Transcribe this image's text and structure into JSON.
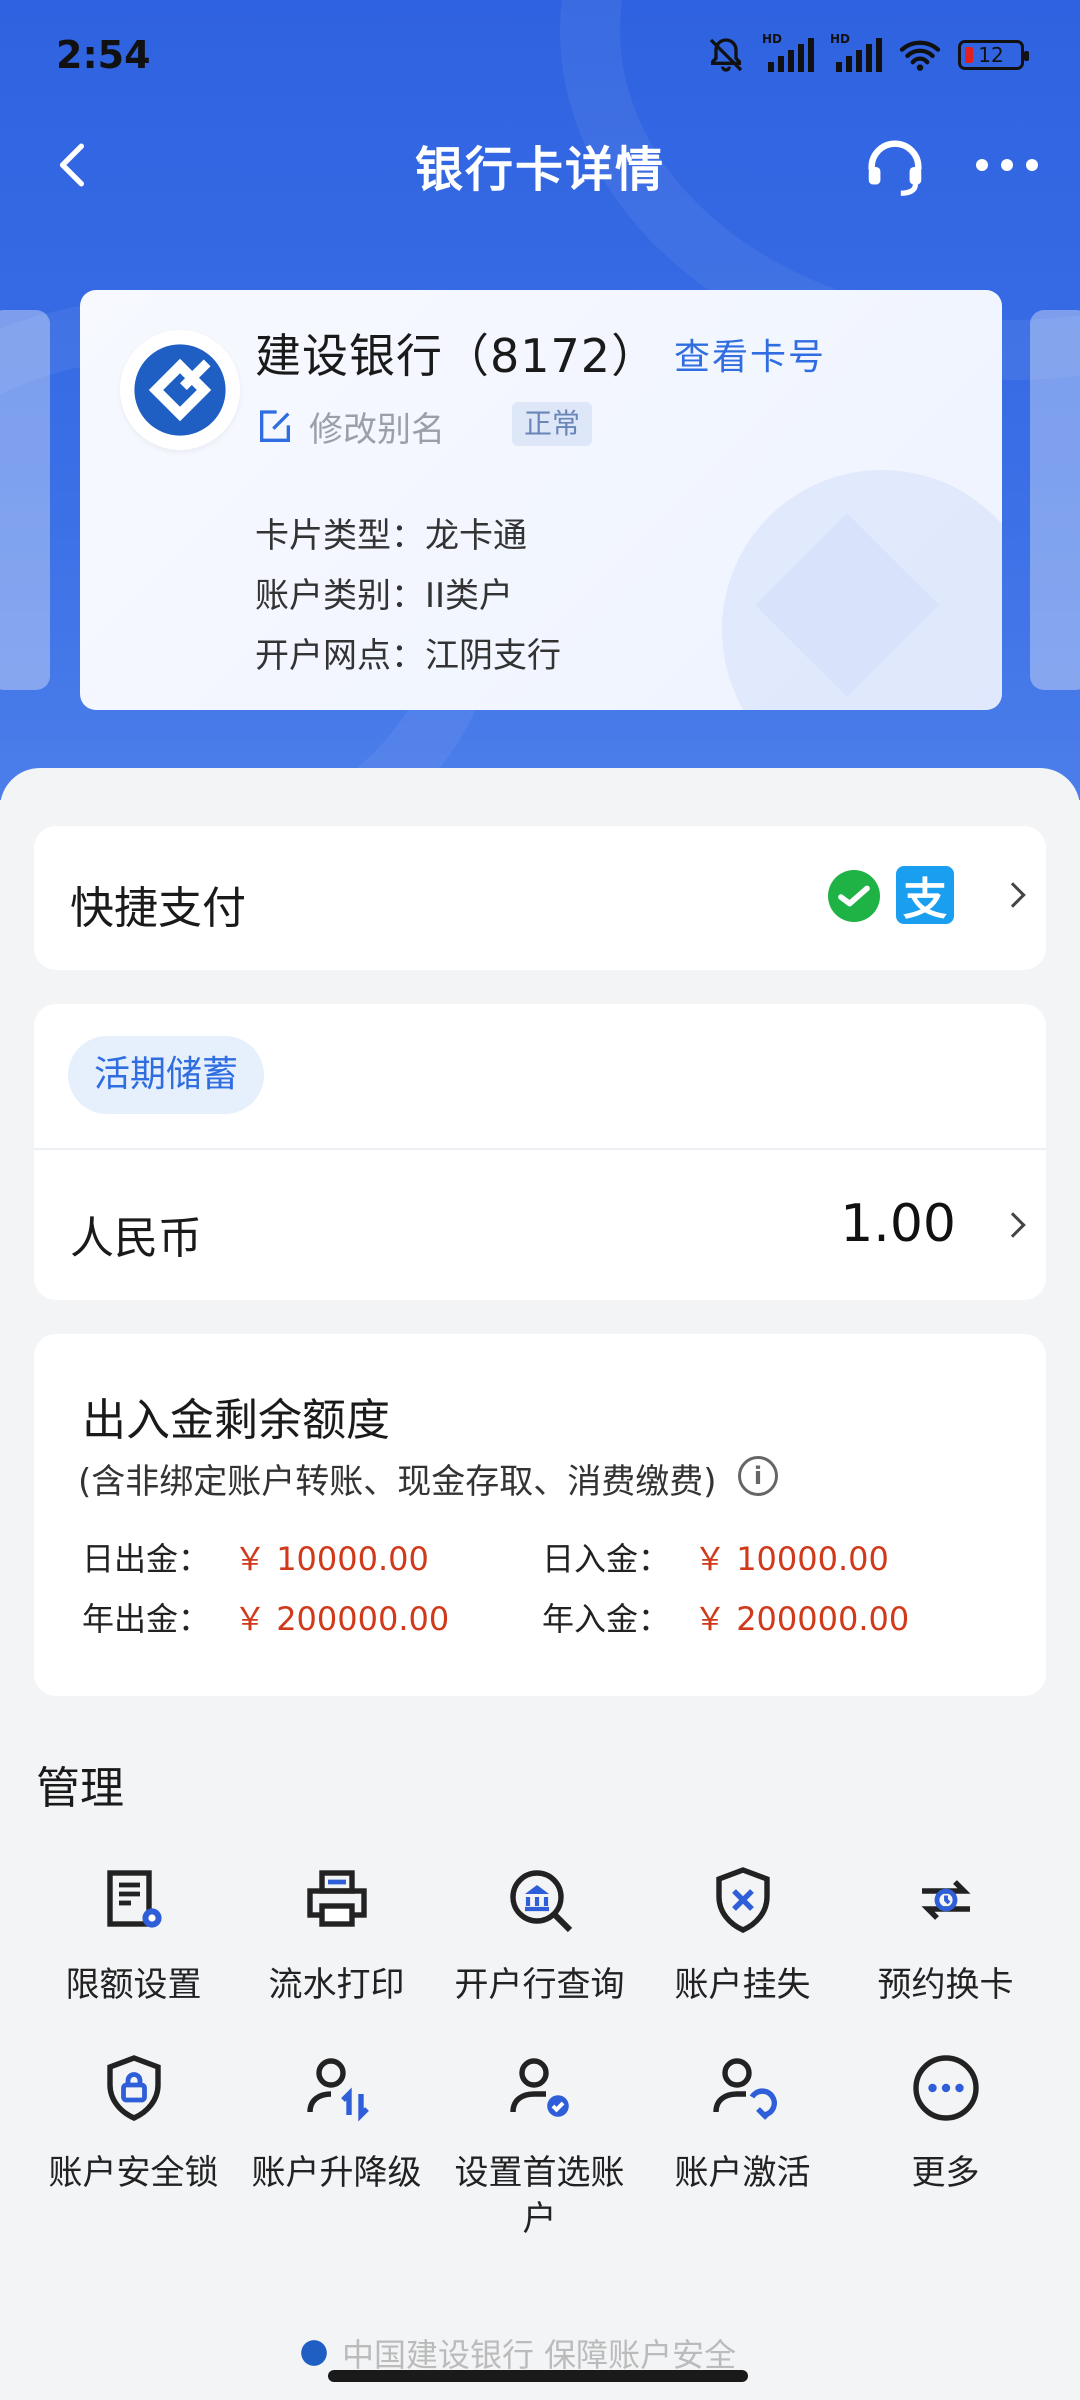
{
  "status": {
    "time": "2:54",
    "battery": "12",
    "hd": "HD"
  },
  "nav": {
    "title": "银行卡详情"
  },
  "card": {
    "bank_name": "建设银行（8172）",
    "view_card_no": "查看卡号",
    "edit_alias": "修改别名",
    "status_badge": "正常",
    "info": [
      {
        "text": "卡片类型：龙卡通"
      },
      {
        "text": "账户类别：II类户"
      },
      {
        "text": "开户网点：江阴支行"
      }
    ]
  },
  "quick_pay": {
    "title": "快捷支付",
    "alipay_glyph": "支"
  },
  "savings": {
    "tag": "活期储蓄",
    "currency": "人民币",
    "balance": "1.00"
  },
  "limits": {
    "title": "出入金剩余额度",
    "subtitle": "(含非绑定账户转账、现金存取、消费缴费)",
    "info_glyph": "i",
    "items": [
      {
        "label": "日出金：",
        "value": "￥ 10000.00"
      },
      {
        "label": "日入金：",
        "value": "￥ 10000.00"
      },
      {
        "label": "年出金：",
        "value": "￥ 200000.00"
      },
      {
        "label": "年入金：",
        "value": "￥ 200000.00"
      }
    ]
  },
  "management": {
    "title": "管理",
    "items": [
      {
        "label": "限额设置",
        "icon": "limit-settings-icon"
      },
      {
        "label": "流水打印",
        "icon": "printer-icon"
      },
      {
        "label": "开户行查询",
        "icon": "bank-search-icon"
      },
      {
        "label": "账户挂失",
        "icon": "shield-x-icon"
      },
      {
        "label": "预约换卡",
        "icon": "card-exchange-icon"
      },
      {
        "label": "账户安全锁",
        "icon": "shield-lock-icon"
      },
      {
        "label": "账户升降级",
        "icon": "user-updown-icon"
      },
      {
        "label": "设置首选账户",
        "icon": "user-check-icon"
      },
      {
        "label": "账户激活",
        "icon": "user-activate-icon"
      },
      {
        "label": "更多",
        "icon": "more-circle-icon"
      }
    ]
  },
  "footer": {
    "note": "中国建设银行 保障账户安全"
  },
  "colors": {
    "brand_blue": "#2f62e0",
    "link_blue": "#2f6de0",
    "amount_red": "#d0391a",
    "accent_icon": "#2f5fd8"
  }
}
